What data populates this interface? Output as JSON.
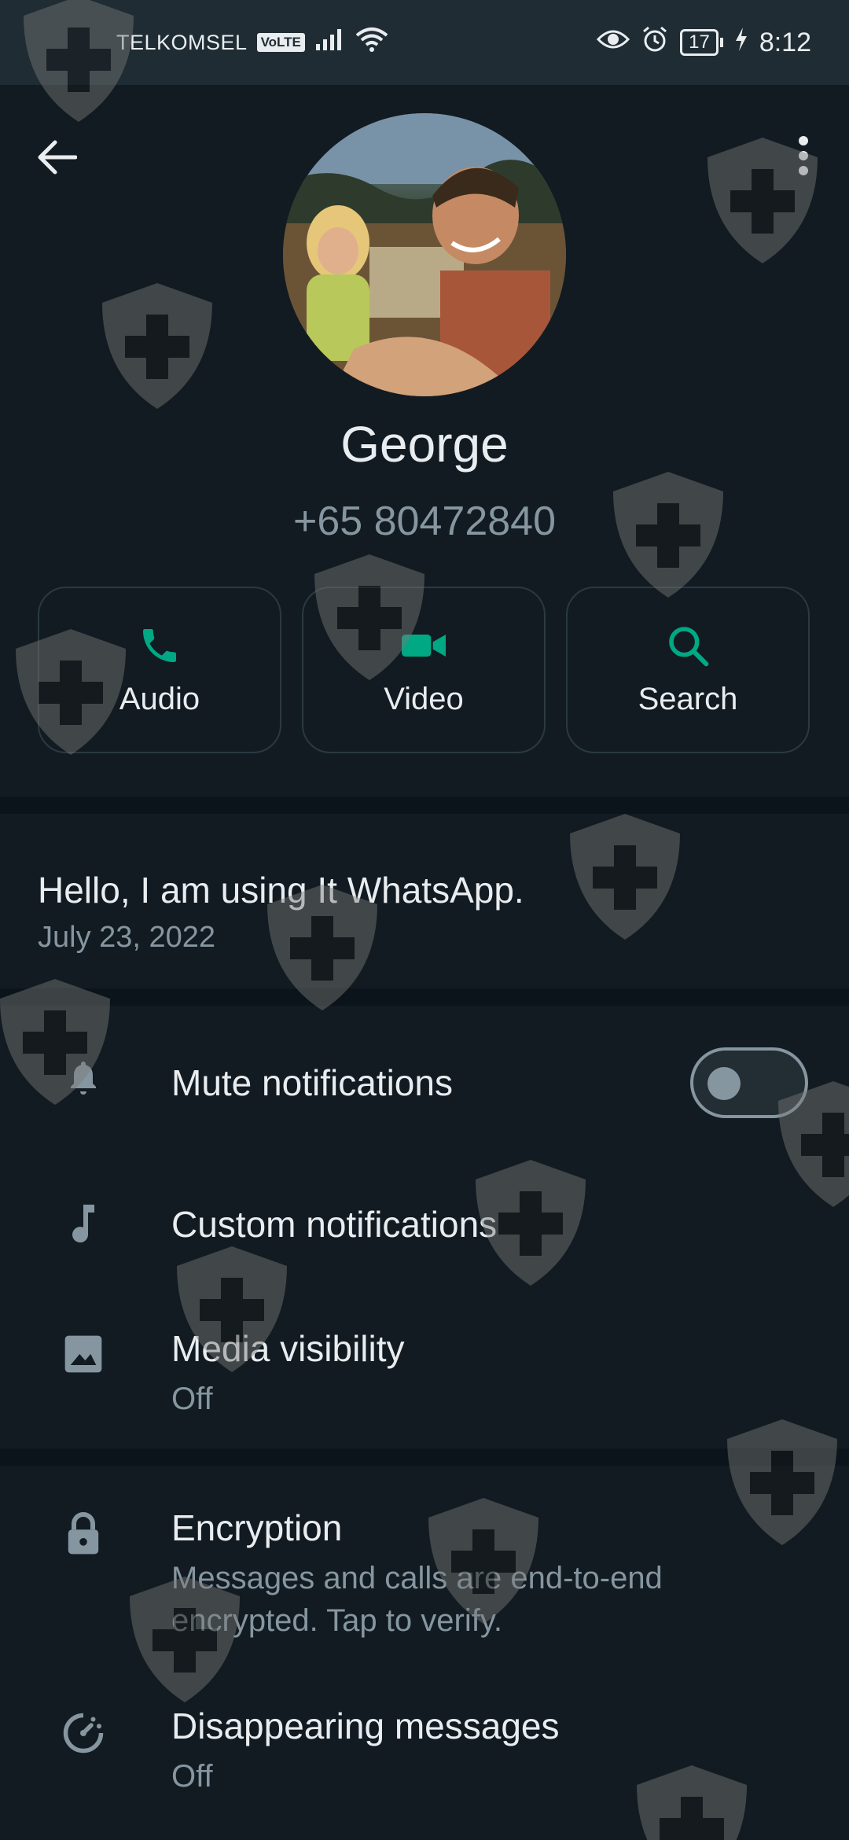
{
  "status_bar": {
    "carrier": "TELKOMSEL",
    "volte": "VoLTE",
    "battery": "17",
    "time": "8:12"
  },
  "contact": {
    "name": "George",
    "phone": "+65 80472840"
  },
  "actions": [
    {
      "label": "Audio",
      "icon": "phone-icon"
    },
    {
      "label": "Video",
      "icon": "video-camera-icon"
    },
    {
      "label": "Search",
      "icon": "search-icon"
    }
  ],
  "about": {
    "text": "Hello, I am using It WhatsApp.",
    "date": "July 23, 2022"
  },
  "settings": {
    "mute": {
      "title": "Mute notifications",
      "enabled": false
    },
    "custom": {
      "title": "Custom notifications"
    },
    "media": {
      "title": "Media visibility",
      "value": "Off"
    },
    "encryption": {
      "title": "Encryption",
      "subtitle_line1": "Messages and calls are end-to-end",
      "subtitle_line2": "encrypted. Tap to verify."
    },
    "disappearing": {
      "title": "Disappearing messages",
      "value": "Off"
    }
  },
  "colors": {
    "accent": "#00a884",
    "background": "#121b22",
    "status_bar": "#1f2c34",
    "secondary_text": "#8696a0"
  }
}
